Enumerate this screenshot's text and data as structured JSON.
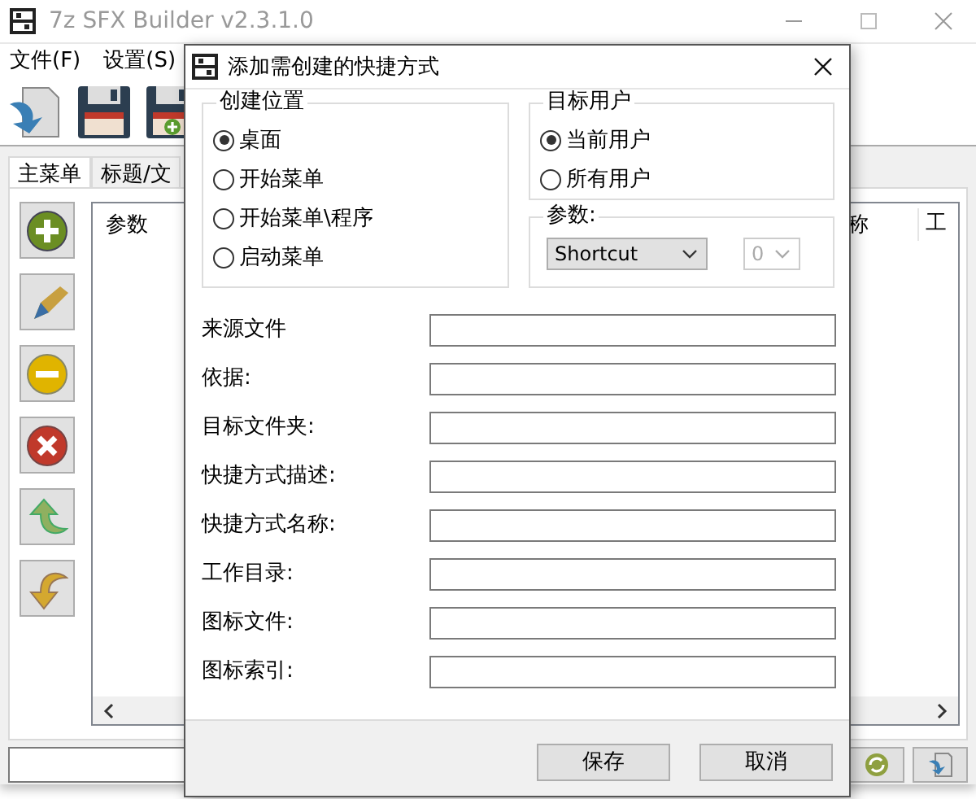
{
  "window": {
    "title": "7z SFX Builder v2.3.1.0"
  },
  "menu": [
    {
      "label": "文件(F)"
    },
    {
      "label": "设置(S)"
    }
  ],
  "tabs": [
    {
      "label": "主菜单",
      "selected": true
    },
    {
      "label": "标题/文",
      "selected": false
    }
  ],
  "list": {
    "columns": [
      "参数",
      "称",
      "工"
    ]
  },
  "dialog": {
    "title": "添加需创建的快捷方式",
    "location_group": {
      "title": "创建位置",
      "options": [
        {
          "label": "桌面",
          "selected": true
        },
        {
          "label": "开始菜单",
          "selected": false
        },
        {
          "label": "开始菜单\\程序",
          "selected": false
        },
        {
          "label": "启动菜单",
          "selected": false
        }
      ]
    },
    "user_group": {
      "title": "目标用户",
      "options": [
        {
          "label": "当前用户",
          "selected": true
        },
        {
          "label": "所有用户",
          "selected": false
        }
      ]
    },
    "params": {
      "title": "参数:",
      "type": {
        "value": "Shortcut",
        "disabled": false
      },
      "index": {
        "value": "0",
        "disabled": true
      }
    },
    "fields": [
      {
        "label": "来源文件"
      },
      {
        "label": "依据:"
      },
      {
        "label": "目标文件夹:"
      },
      {
        "label": "快捷方式描述:"
      },
      {
        "label": "快捷方式名称:"
      },
      {
        "label": "工作目录:"
      },
      {
        "label": "图标文件:"
      },
      {
        "label": "图标索引:"
      }
    ],
    "buttons": [
      "保存",
      "取消"
    ]
  }
}
